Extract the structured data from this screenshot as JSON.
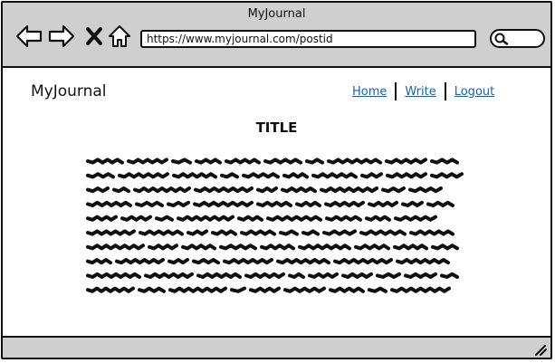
{
  "window": {
    "title": "MyJournal"
  },
  "toolbar": {
    "back_icon": "arrow-left-icon",
    "forward_icon": "arrow-right-icon",
    "stop_icon": "close-icon",
    "home_icon": "home-icon",
    "url": "https://www.myjournal.com/postid",
    "search_icon": "search-icon"
  },
  "site": {
    "brand": "MyJournal",
    "nav": [
      {
        "label": "Home"
      },
      {
        "label": "Write"
      },
      {
        "label": "Logout"
      }
    ]
  },
  "post": {
    "title": "TITLE",
    "body_lines": 10
  },
  "colors": {
    "chrome": "#cfcfcf",
    "link": "#1f5fb0",
    "ink": "#111111"
  }
}
